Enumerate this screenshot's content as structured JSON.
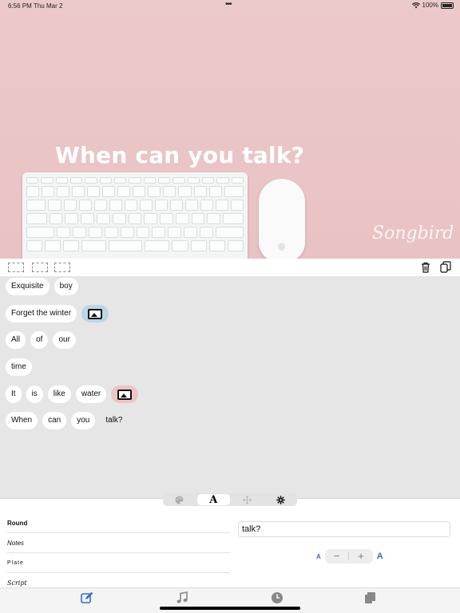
{
  "status": {
    "time": "6:56 PM",
    "date": "Thu Mar 2",
    "battery": "100%"
  },
  "hero": {
    "title": "When can you talk?",
    "watermark": "Songbird"
  },
  "lines": [
    {
      "words": [
        "Exquisite",
        "boy"
      ]
    },
    {
      "words": [
        "Forget the winter"
      ],
      "image": "blue"
    },
    {
      "words": [
        "All",
        "of",
        "our"
      ]
    },
    {
      "words": [
        "time"
      ]
    },
    {
      "words": [
        "It",
        "is",
        "like",
        "water"
      ],
      "image": "pink"
    },
    {
      "words": [
        "When",
        "can",
        "you",
        "talk?"
      ]
    }
  ],
  "tabs_top": {
    "palette_icon": "palette-icon",
    "font_label": "A",
    "move_icon": "move-icon",
    "settings_icon": "gear-icon"
  },
  "fonts": [
    "Round",
    "Notes",
    "Plate",
    "Script"
  ],
  "text_field": {
    "value": "talk?"
  },
  "size": {
    "small_label": "A",
    "large_label": "A",
    "minus": "−",
    "plus": "+"
  },
  "colors": {
    "accent": "#2f6bd0",
    "hero_bg": "#ecc9ca"
  }
}
